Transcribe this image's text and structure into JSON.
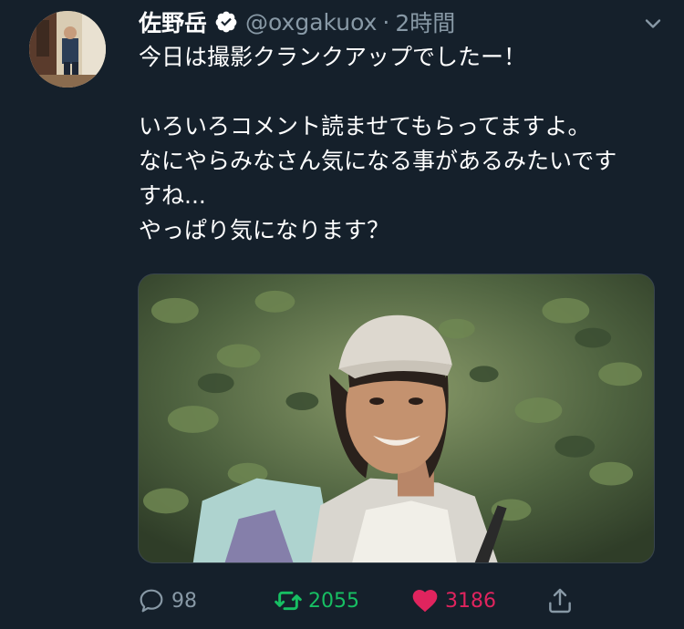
{
  "tweet": {
    "author_name": "佐野岳",
    "handle": "@oxgakuox",
    "separator": "·",
    "time": "2時間",
    "verified": true,
    "text": "今日は撮影クランクアップでしたー！\n\nいろいろコメント読ませてもらってますよ。\nなにやらみなさん気になる事があるみたいです\nすね...\nやっぱり気になります？",
    "lines": [
      "今日は撮影クランクアップでしたー！",
      "",
      "いろいろコメント読ませてもらってますよ。",
      "なにやらみなさん気になる事があるみたいで",
      "すね...",
      "やっぱり気になります？"
    ]
  },
  "actions": {
    "reply_count": "98",
    "retweet_count": "2055",
    "like_count": "3186"
  },
  "icons": {
    "verified": "verified-badge-icon",
    "more": "chevron-down-icon",
    "reply": "reply-icon",
    "retweet": "retweet-icon",
    "like": "heart-icon",
    "share": "share-icon"
  },
  "colors": {
    "background": "#15202b",
    "secondary_text": "#8899a6",
    "retweet_active": "#17bf63",
    "like_active": "#e0245e"
  }
}
